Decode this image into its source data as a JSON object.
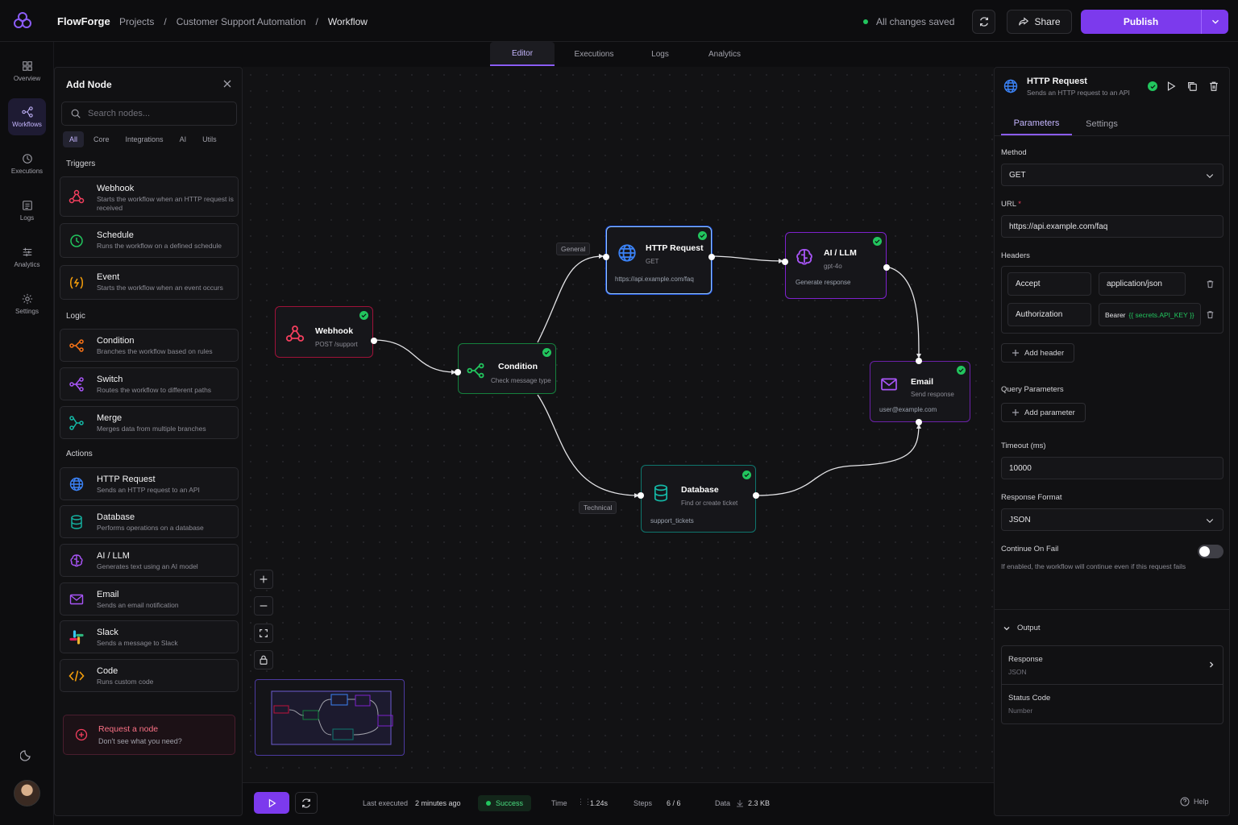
{
  "app": {
    "brand": "FlowForge"
  },
  "breadcrumb": {
    "items": [
      "Projects",
      "Customer Support Automation",
      "Workflow"
    ],
    "sep": "/"
  },
  "header": {
    "saved_status": "All changes saved",
    "share_label": "Share",
    "publish_label": "Publish"
  },
  "rail": {
    "items": [
      "Overview",
      "Workflows",
      "Executions",
      "Logs",
      "Analytics",
      "Settings"
    ],
    "active": "Workflows"
  },
  "view_tabs": {
    "items": [
      "Editor",
      "Executions",
      "Logs",
      "Analytics"
    ],
    "active": "Editor"
  },
  "add_node": {
    "title": "Add Node",
    "search_placeholder": "Search nodes...",
    "filters": [
      "All",
      "Core",
      "Integrations",
      "AI",
      "Utils"
    ],
    "sections": {
      "triggers": "Triggers",
      "logic": "Logic",
      "actions": "Actions"
    },
    "triggers": [
      {
        "title": "Webhook",
        "desc": "Starts the workflow when an HTTP request is received",
        "icon": "webhook-icon"
      },
      {
        "title": "Schedule",
        "desc": "Runs the workflow on a defined schedule",
        "icon": "clock-icon"
      },
      {
        "title": "Event",
        "desc": "Starts the workflow when an event occurs",
        "icon": "event-icon"
      }
    ],
    "logic": [
      {
        "title": "Condition",
        "desc": "Branches the workflow based on rules",
        "icon": "branch-icon"
      },
      {
        "title": "Switch",
        "desc": "Routes the workflow to different paths",
        "icon": "switch-icon"
      },
      {
        "title": "Merge",
        "desc": "Merges data from multiple branches",
        "icon": "merge-icon"
      }
    ],
    "actions": [
      {
        "title": "HTTP Request",
        "desc": "Sends an HTTP request to an API",
        "icon": "globe-icon"
      },
      {
        "title": "Database",
        "desc": "Performs operations on a database",
        "icon": "database-icon"
      },
      {
        "title": "AI / LLM",
        "desc": "Generates text using an AI model",
        "icon": "brain-icon"
      },
      {
        "title": "Email",
        "desc": "Sends an email notification",
        "icon": "mail-icon"
      },
      {
        "title": "Slack",
        "desc": "Sends a message to Slack",
        "icon": "slack-icon"
      },
      {
        "title": "Code",
        "desc": "Runs custom code",
        "icon": "code-icon"
      }
    ],
    "request": {
      "title": "Request a node",
      "desc": "Don't see what you need?"
    }
  },
  "nodes": {
    "webhook": {
      "title": "Webhook",
      "sub": "POST /support"
    },
    "condition": {
      "title": "Condition",
      "sub": "Check message type"
    },
    "http": {
      "title": "HTTP Request",
      "sub": "GET",
      "extra": "https://api.example.com/faq"
    },
    "ai": {
      "title": "AI / LLM",
      "sub": "gpt-4o",
      "extra": "Generate response"
    },
    "email": {
      "title": "Email",
      "sub": "Send response",
      "extra": "user@example.com"
    },
    "database": {
      "title": "Database",
      "sub": "Find or create ticket",
      "extra": "support_tickets"
    }
  },
  "edge_labels": {
    "general": "General",
    "technical": "Technical"
  },
  "status": {
    "last_executed_label": "Last executed",
    "last_executed_value": "2 minutes ago",
    "result": "Success",
    "time_label": "Time",
    "time_value": "1.24s",
    "steps_label": "Steps",
    "steps_value": "6 / 6",
    "data_label": "Data",
    "data_value": "2.3 KB"
  },
  "inspector": {
    "title": "HTTP Request",
    "desc": "Sends an HTTP request to an API",
    "tabs": [
      "Parameters",
      "Settings"
    ],
    "method_label": "Method",
    "method_value": "GET",
    "url_label": "URL",
    "url_required": "*",
    "url_value": "https://api.example.com/faq",
    "headers_label": "Headers",
    "headers": [
      {
        "key": "Accept",
        "value": "application/json"
      },
      {
        "key": "Authorization",
        "value_prefix": "Bearer",
        "value_expr": "{{ secrets.API_KEY }}"
      }
    ],
    "add_header": "Add header",
    "query_label": "Query Parameters",
    "add_param": "Add parameter",
    "timeout_label": "Timeout (ms)",
    "timeout_value": "10000",
    "format_label": "Response Format",
    "format_value": "JSON",
    "continue_label": "Continue On Fail",
    "continue_desc": "If enabled, the workflow will continue even if this request fails",
    "continue_on": false,
    "output_label": "Output",
    "outputs": [
      {
        "name": "Response",
        "type": "JSON"
      },
      {
        "name": "Status Code",
        "type": "Number"
      }
    ],
    "help": "Help"
  },
  "colors": {
    "accent": "#7c3aed",
    "success": "#22c55e",
    "webhook": "#f43f5e",
    "logic": "#22c55e",
    "http": "#3b82f6",
    "ai": "#a855f7",
    "db": "#14b8a6"
  }
}
